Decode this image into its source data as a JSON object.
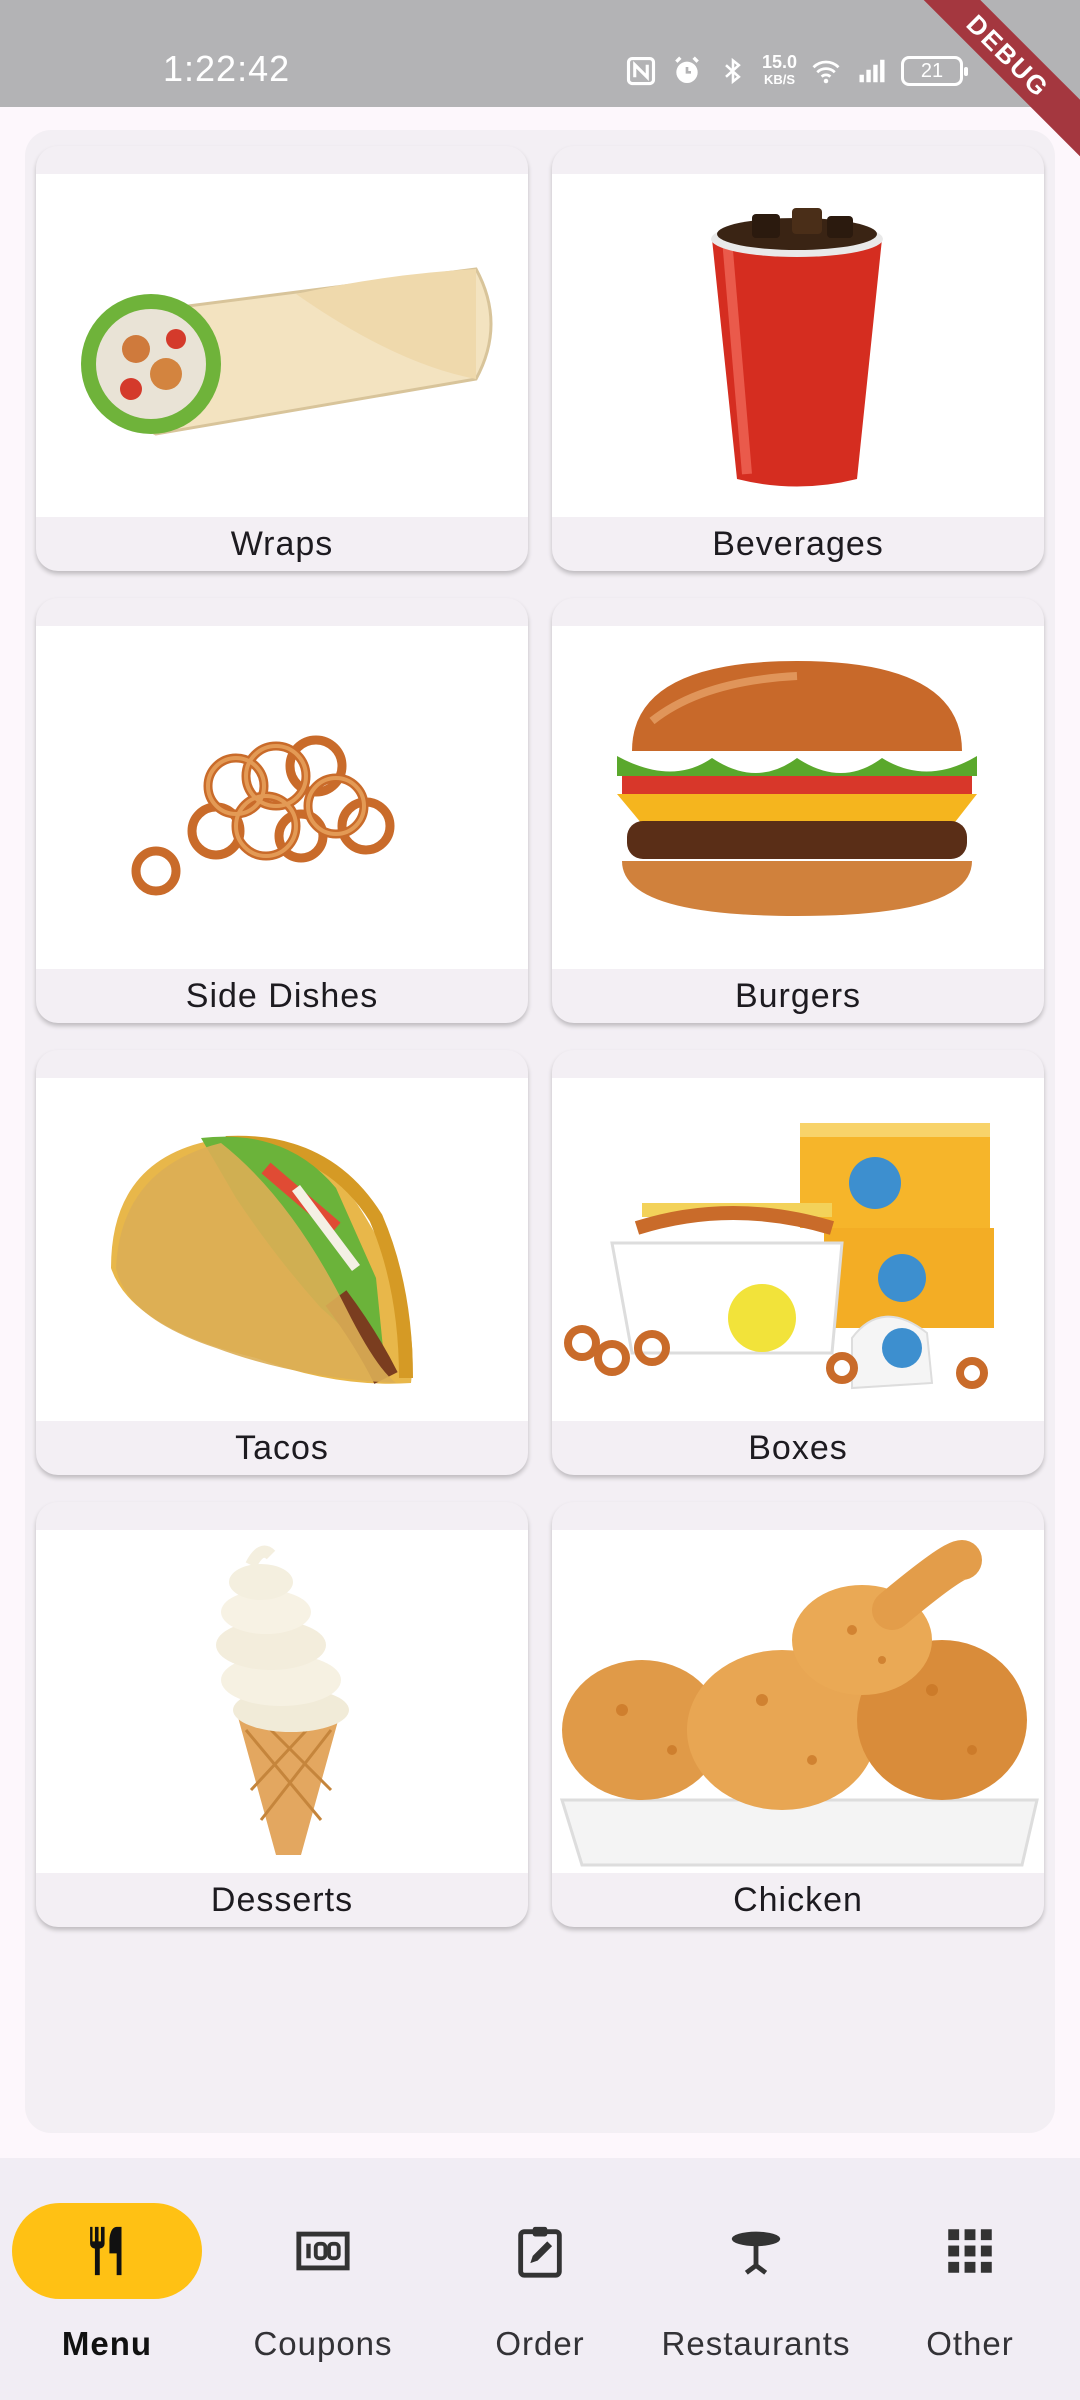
{
  "status_bar": {
    "time": "1:22:42",
    "net_speed_value": "15.0",
    "net_speed_unit": "KB/S",
    "battery": "21",
    "debug_banner": "DEBUG"
  },
  "menu": {
    "categories": [
      {
        "label": "Wraps",
        "icon": "wrap-image"
      },
      {
        "label": "Beverages",
        "icon": "cup-image"
      },
      {
        "label": "Side Dishes",
        "icon": "curly-fries-image"
      },
      {
        "label": "Burgers",
        "icon": "burger-image"
      },
      {
        "label": "Tacos",
        "icon": "taco-image"
      },
      {
        "label": "Boxes",
        "icon": "box-meal-image"
      },
      {
        "label": "Desserts",
        "icon": "ice-cream-image"
      },
      {
        "label": "Chicken",
        "icon": "fried-chicken-image"
      }
    ]
  },
  "nav": {
    "items": [
      {
        "label": "Menu",
        "icon": "utensils-icon",
        "active": true
      },
      {
        "label": "Coupons",
        "icon": "coupon-icon",
        "active": false
      },
      {
        "label": "Order",
        "icon": "clipboard-edit-icon",
        "active": false
      },
      {
        "label": "Restaurants",
        "icon": "table-icon",
        "active": false
      },
      {
        "label": "Other",
        "icon": "grid-icon",
        "active": false
      }
    ]
  },
  "colors": {
    "accent": "#ffc114",
    "panel": "#f3eff4",
    "status_bar": "#b3b3b5",
    "debug_ribbon": "#a4373f"
  }
}
